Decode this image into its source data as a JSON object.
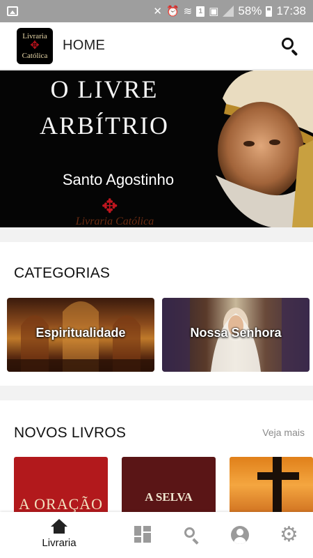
{
  "status_bar": {
    "battery": "58%",
    "time": "17:38",
    "sim_label": "1"
  },
  "app_bar": {
    "title": "HOME",
    "logo_line1": "Livraria",
    "logo_line2": "Católica"
  },
  "banner": {
    "title_line1": "O LIVRE",
    "title_line2": "ARBÍTRIO",
    "author": "Santo Agostinho",
    "brand": "Livraria Católica"
  },
  "categories": {
    "heading": "CATEGORIAS",
    "items": [
      {
        "label": "Espiritualidade"
      },
      {
        "label": "Nossa Senhora"
      }
    ]
  },
  "new_books": {
    "heading": "NOVOS LIVROS",
    "see_more": "Veja mais",
    "items": [
      {
        "title": "A ORAÇÃO"
      },
      {
        "title": "A SELVA"
      }
    ]
  },
  "bottom_nav": {
    "home_label": "Livraria"
  },
  "colors": {
    "status_bar": "#9e9e9e",
    "accent_red": "#b2191c",
    "nav_inactive": "#9a9a9a"
  }
}
